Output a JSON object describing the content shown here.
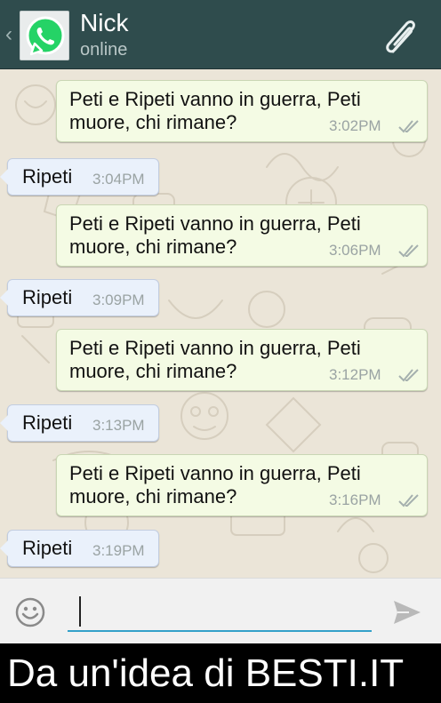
{
  "header": {
    "contact_name": "Nick",
    "status": "online",
    "back_glyph": "‹",
    "icons": {
      "back": "chevron-left-icon",
      "avatar": "whatsapp-logo-icon",
      "attach": "paperclip-icon"
    },
    "colors": {
      "bar": "#2f4c4d",
      "logo_green": "#25d366"
    }
  },
  "messages": [
    {
      "direction": "out",
      "line1": "Peti e Ripeti vanno in guerra, Peti",
      "line2": "muore, chi rimane?",
      "time": "3:02PM"
    },
    {
      "direction": "in",
      "line1": "Ripeti",
      "time": "3:04PM"
    },
    {
      "direction": "out",
      "line1": "Peti e Ripeti vanno in guerra, Peti",
      "line2": "muore, chi rimane?",
      "time": "3:06PM"
    },
    {
      "direction": "in",
      "line1": "Ripeti",
      "time": "3:09PM"
    },
    {
      "direction": "out",
      "line1": "Peti e Ripeti vanno in guerra, Peti",
      "line2": "muore, chi rimane?",
      "time": "3:12PM"
    },
    {
      "direction": "in",
      "line1": "Ripeti",
      "time": "3:13PM"
    },
    {
      "direction": "out",
      "line1": "Peti e Ripeti vanno in guerra, Peti",
      "line2": "muore, chi rimane?",
      "time": "3:16PM"
    },
    {
      "direction": "in",
      "line1": "Ripeti",
      "time": "3:19PM"
    }
  ],
  "input": {
    "value": "",
    "placeholder": "",
    "icons": {
      "emoji": "smiley-icon",
      "send": "send-arrow-icon"
    },
    "accent": "#33a1c9"
  },
  "footer": {
    "text": "Da un'idea di BESTI.IT"
  },
  "colors": {
    "chat_bg": "#ebe5d8",
    "bubble_out": "#f4fbe4",
    "bubble_in": "#eaf1fb"
  }
}
